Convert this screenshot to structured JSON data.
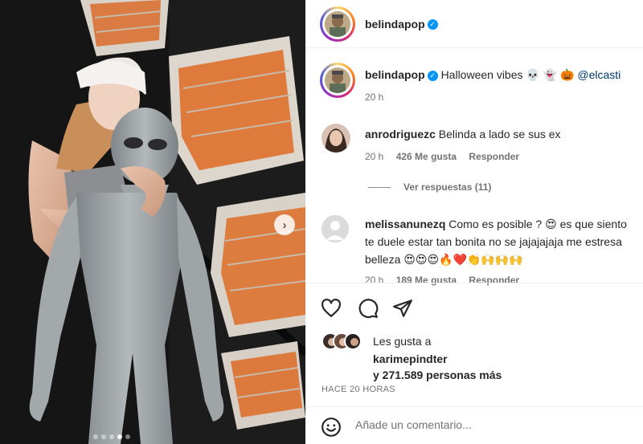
{
  "post": {
    "username": "belindapop",
    "caption_text": "Halloween vibes",
    "caption_emojis": "💀 👻 🎃",
    "caption_mention": "@elcasti",
    "caption_time": "20 h"
  },
  "comments": [
    {
      "username": "anrodriguezc",
      "text": "Belinda a lado se sus ex",
      "time": "20 h",
      "likes": "426 Me gusta",
      "reply_label": "Responder",
      "view_replies": "Ver respuestas (11)"
    },
    {
      "username": "melissanunezq",
      "text_line1": "Como es posible ?",
      "emoji1": "😍",
      "text_line1b": "es que siento",
      "text_line2": "te duele estar tan bonita no se jajajajaja me estresa",
      "text_line3": "belleza",
      "emojis_line3": "😍😍😍🔥❤️👏🙌🙌🙌",
      "time": "20 h",
      "likes": "189 Me gusta",
      "reply_label": "Responder"
    }
  ],
  "likes": {
    "prefix": "Les gusta a",
    "user": "karimepindter",
    "rest": "y 271.589 personas más"
  },
  "timestamp": "HACE 20 HORAS",
  "comment_input": {
    "placeholder": "Añade un comentario..."
  },
  "icons": {
    "next": "chevron-right-icon",
    "heart": "heart-icon",
    "comment": "comment-icon",
    "share": "send-icon",
    "emoji": "emoji-icon",
    "verified": "verified-badge-icon"
  },
  "carousel": {
    "count": 5,
    "active_index": 3
  },
  "colors": {
    "verified_blue": "#0095f6",
    "mention_blue": "#00376b",
    "muted_gray": "#737373",
    "heart_red": "#ed4956"
  }
}
